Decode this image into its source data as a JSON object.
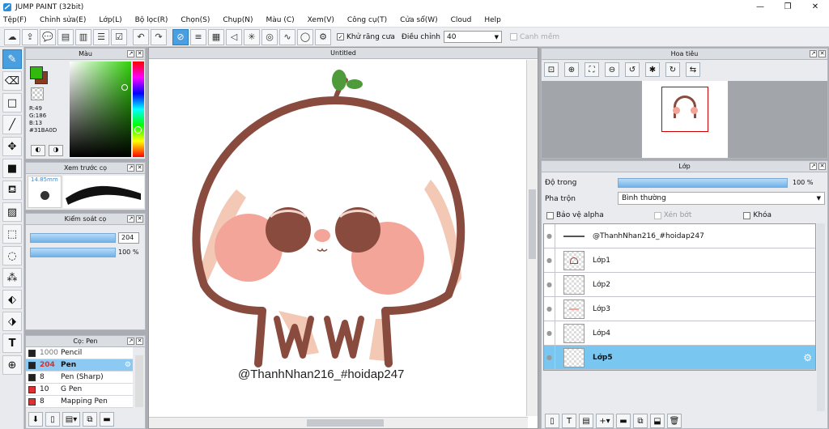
{
  "app": {
    "title": "JUMP PAINT (32bit)"
  },
  "window_buttons": [
    "—",
    "❐",
    "✕"
  ],
  "menu": [
    "Tệp(F)",
    "Chỉnh sửa(E)",
    "Lớp(L)",
    "Bộ lọc(R)",
    "Chọn(S)",
    "Chụp(N)",
    "Màu (C)",
    "Xem(V)",
    "Công cụ(T)",
    "Cửa sổ(W)",
    "Cloud",
    "Help"
  ],
  "toolbar": {
    "antialias_label": "Khử răng cưa",
    "adjust_label": "Điều chỉnh",
    "adjust_value": "40",
    "snap_label": "Canh mềm"
  },
  "color_panel": {
    "title": "Màu",
    "r": "R:49",
    "g": "G:186",
    "b": "B:13",
    "hex": "#31BA0D",
    "fg_color": "#31BA0D",
    "bg_color": "#8B3A22"
  },
  "brush_preview": {
    "title": "Xem trước cọ",
    "size": "14.85mm"
  },
  "brush_control": {
    "title": "Kiểm soát cọ",
    "size_value": "204",
    "opacity_value": "100 %"
  },
  "brush_list": {
    "title": "Cọ: Pen",
    "items": [
      {
        "size": "1000",
        "name": "Pencil",
        "color": "#222222",
        "selected": false
      },
      {
        "size": "204",
        "name": "Pen",
        "color": "#222222",
        "selected": true
      },
      {
        "size": "8",
        "name": "Pen (Sharp)",
        "color": "#222222",
        "selected": false
      },
      {
        "size": "10",
        "name": "G Pen",
        "color": "#e03030",
        "selected": false
      },
      {
        "size": "8",
        "name": "Mapping Pen",
        "color": "#e03030",
        "selected": false
      }
    ]
  },
  "canvas": {
    "tab_title": "Untitled",
    "watermark": "@ThanhNhan216_#hoidap247"
  },
  "navigator": {
    "title": "Hoa tiêu"
  },
  "layers": {
    "title": "Lớp",
    "opacity_label": "Độ trong",
    "opacity_value": "100 %",
    "blend_label": "Pha trộn",
    "blend_value": "Bình thường",
    "protect_alpha": "Bảo vệ alpha",
    "clip": "Xén bớt",
    "lock": "Khóa",
    "items": [
      {
        "name": "@ThanhNhan216_#hoidap247",
        "selected": false
      },
      {
        "name": "Lớp1",
        "selected": false
      },
      {
        "name": "Lớp2",
        "selected": false
      },
      {
        "name": "Lớp3",
        "selected": false
      },
      {
        "name": "Lớp4",
        "selected": false
      },
      {
        "name": "Lớp5",
        "selected": true
      }
    ]
  }
}
